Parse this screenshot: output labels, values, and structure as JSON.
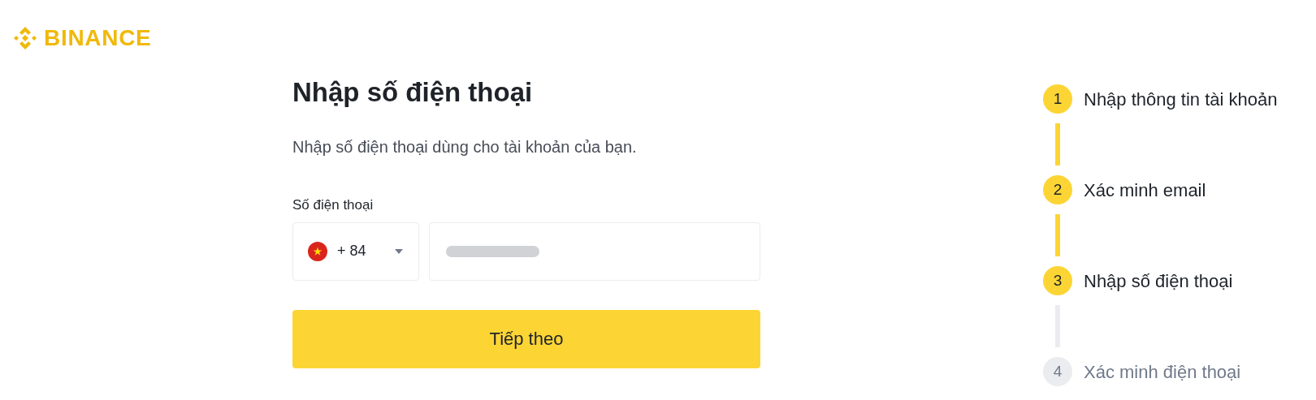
{
  "logo": {
    "text": "BINANCE"
  },
  "form": {
    "title": "Nhập số điện thoại",
    "subtitle": "Nhập số điện thoại dùng cho tài khoản của bạn.",
    "phone_label": "Số điện thoại",
    "country_code": "+ 84",
    "phone_value_redacted": true,
    "submit": "Tiếp theo"
  },
  "steps": [
    {
      "number": "1",
      "label": "Nhập thông tin tài khoản",
      "active": true
    },
    {
      "number": "2",
      "label": "Xác minh email",
      "active": true
    },
    {
      "number": "3",
      "label": "Nhập số điện thoại",
      "active": true
    },
    {
      "number": "4",
      "label": "Xác minh điện thoại",
      "active": false
    }
  ]
}
